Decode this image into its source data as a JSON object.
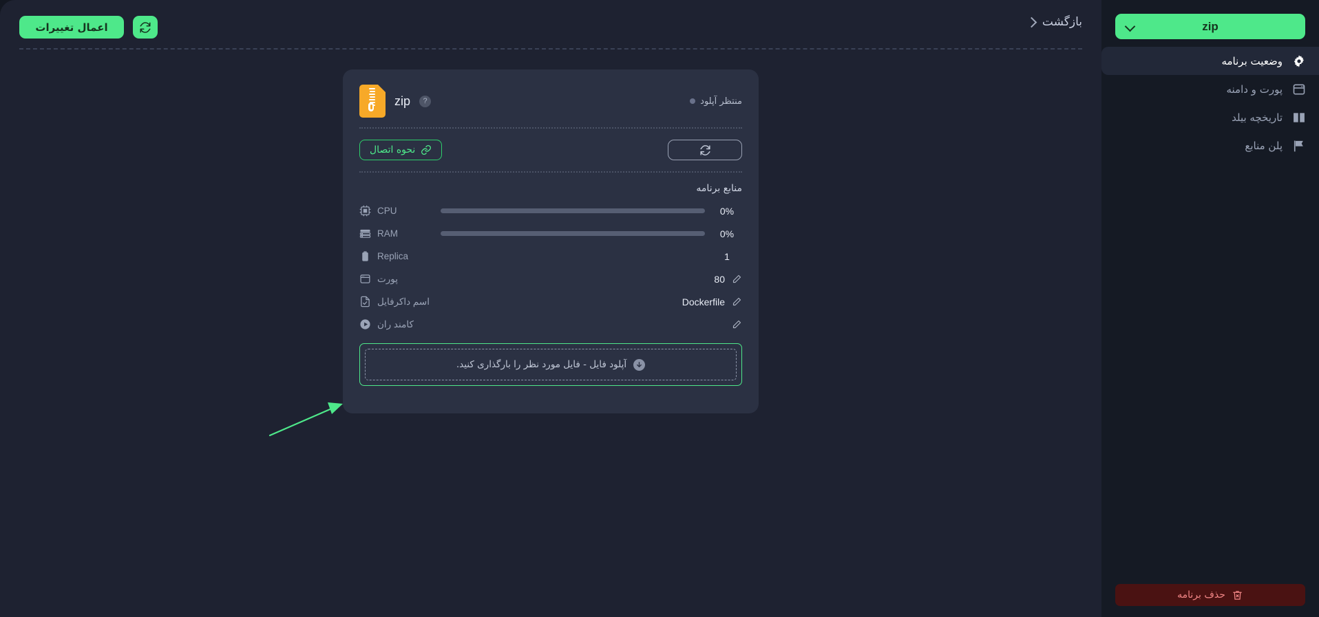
{
  "toolbar": {
    "apply_label": "اعمال تغییرات",
    "refresh_icon": "refresh-icon",
    "back_label": "بازگشت",
    "back_chevron_icon": "chevron-right-icon"
  },
  "card": {
    "file_type_icon": "zip-file-icon",
    "app_name": "zip",
    "help_icon": "help-circle-icon",
    "status_label": "منتظر آپلود",
    "status_dot_color": "#69718a",
    "connection_button_label": "نحوه اتصال",
    "connection_button_icon": "link-icon",
    "refresh_button_icon": "refresh-icon",
    "resources_title": "منابع برنامه",
    "resources": [
      {
        "icon": "cpu-icon",
        "name": "CPU",
        "value": "0%",
        "type": "bar",
        "percent": 0,
        "editable": false
      },
      {
        "icon": "ram-icon",
        "name": "RAM",
        "value": "0%",
        "type": "bar",
        "percent": 0,
        "editable": false
      },
      {
        "icon": "replica-icon",
        "name": "Replica",
        "value": "1",
        "type": "text",
        "editable": false
      },
      {
        "icon": "port-icon",
        "name": "پورت",
        "value": "80",
        "type": "text",
        "editable": true
      },
      {
        "icon": "dockerfile-icon",
        "name": "اسم داکرفایل",
        "value": "Dockerfile",
        "type": "text",
        "editable": true
      },
      {
        "icon": "run-command-icon",
        "name": "کامند ران",
        "value": "",
        "type": "text",
        "editable": true
      }
    ],
    "upload": {
      "icon": "download-circle-icon",
      "text": "آپلود فایل - فایل مورد نظر را بارگذاری کنید."
    }
  },
  "annotation": {
    "arrow_color": "#4ee88a",
    "points_to": "upload-dropzone"
  },
  "sidebar": {
    "app_button_label": "zip",
    "app_button_chevron_icon": "chevron-down-icon",
    "items": [
      {
        "icon": "gear-icon",
        "label": "وضعیت برنامه",
        "active": true
      },
      {
        "icon": "port-icon",
        "label": "پورت و دامنه",
        "active": false
      },
      {
        "icon": "book-icon",
        "label": "تاریخچه بیلد",
        "active": false
      },
      {
        "icon": "flag-icon",
        "label": "پلن منابع",
        "active": false
      }
    ],
    "delete_label": "حذف برنامه",
    "delete_icon": "trash-x-icon"
  },
  "colors": {
    "accent_green": "#4ee88a",
    "card_bg": "#2b3143",
    "main_bg": "#1e2231",
    "sidebar_bg": "#151a24",
    "danger": "#f08585"
  }
}
